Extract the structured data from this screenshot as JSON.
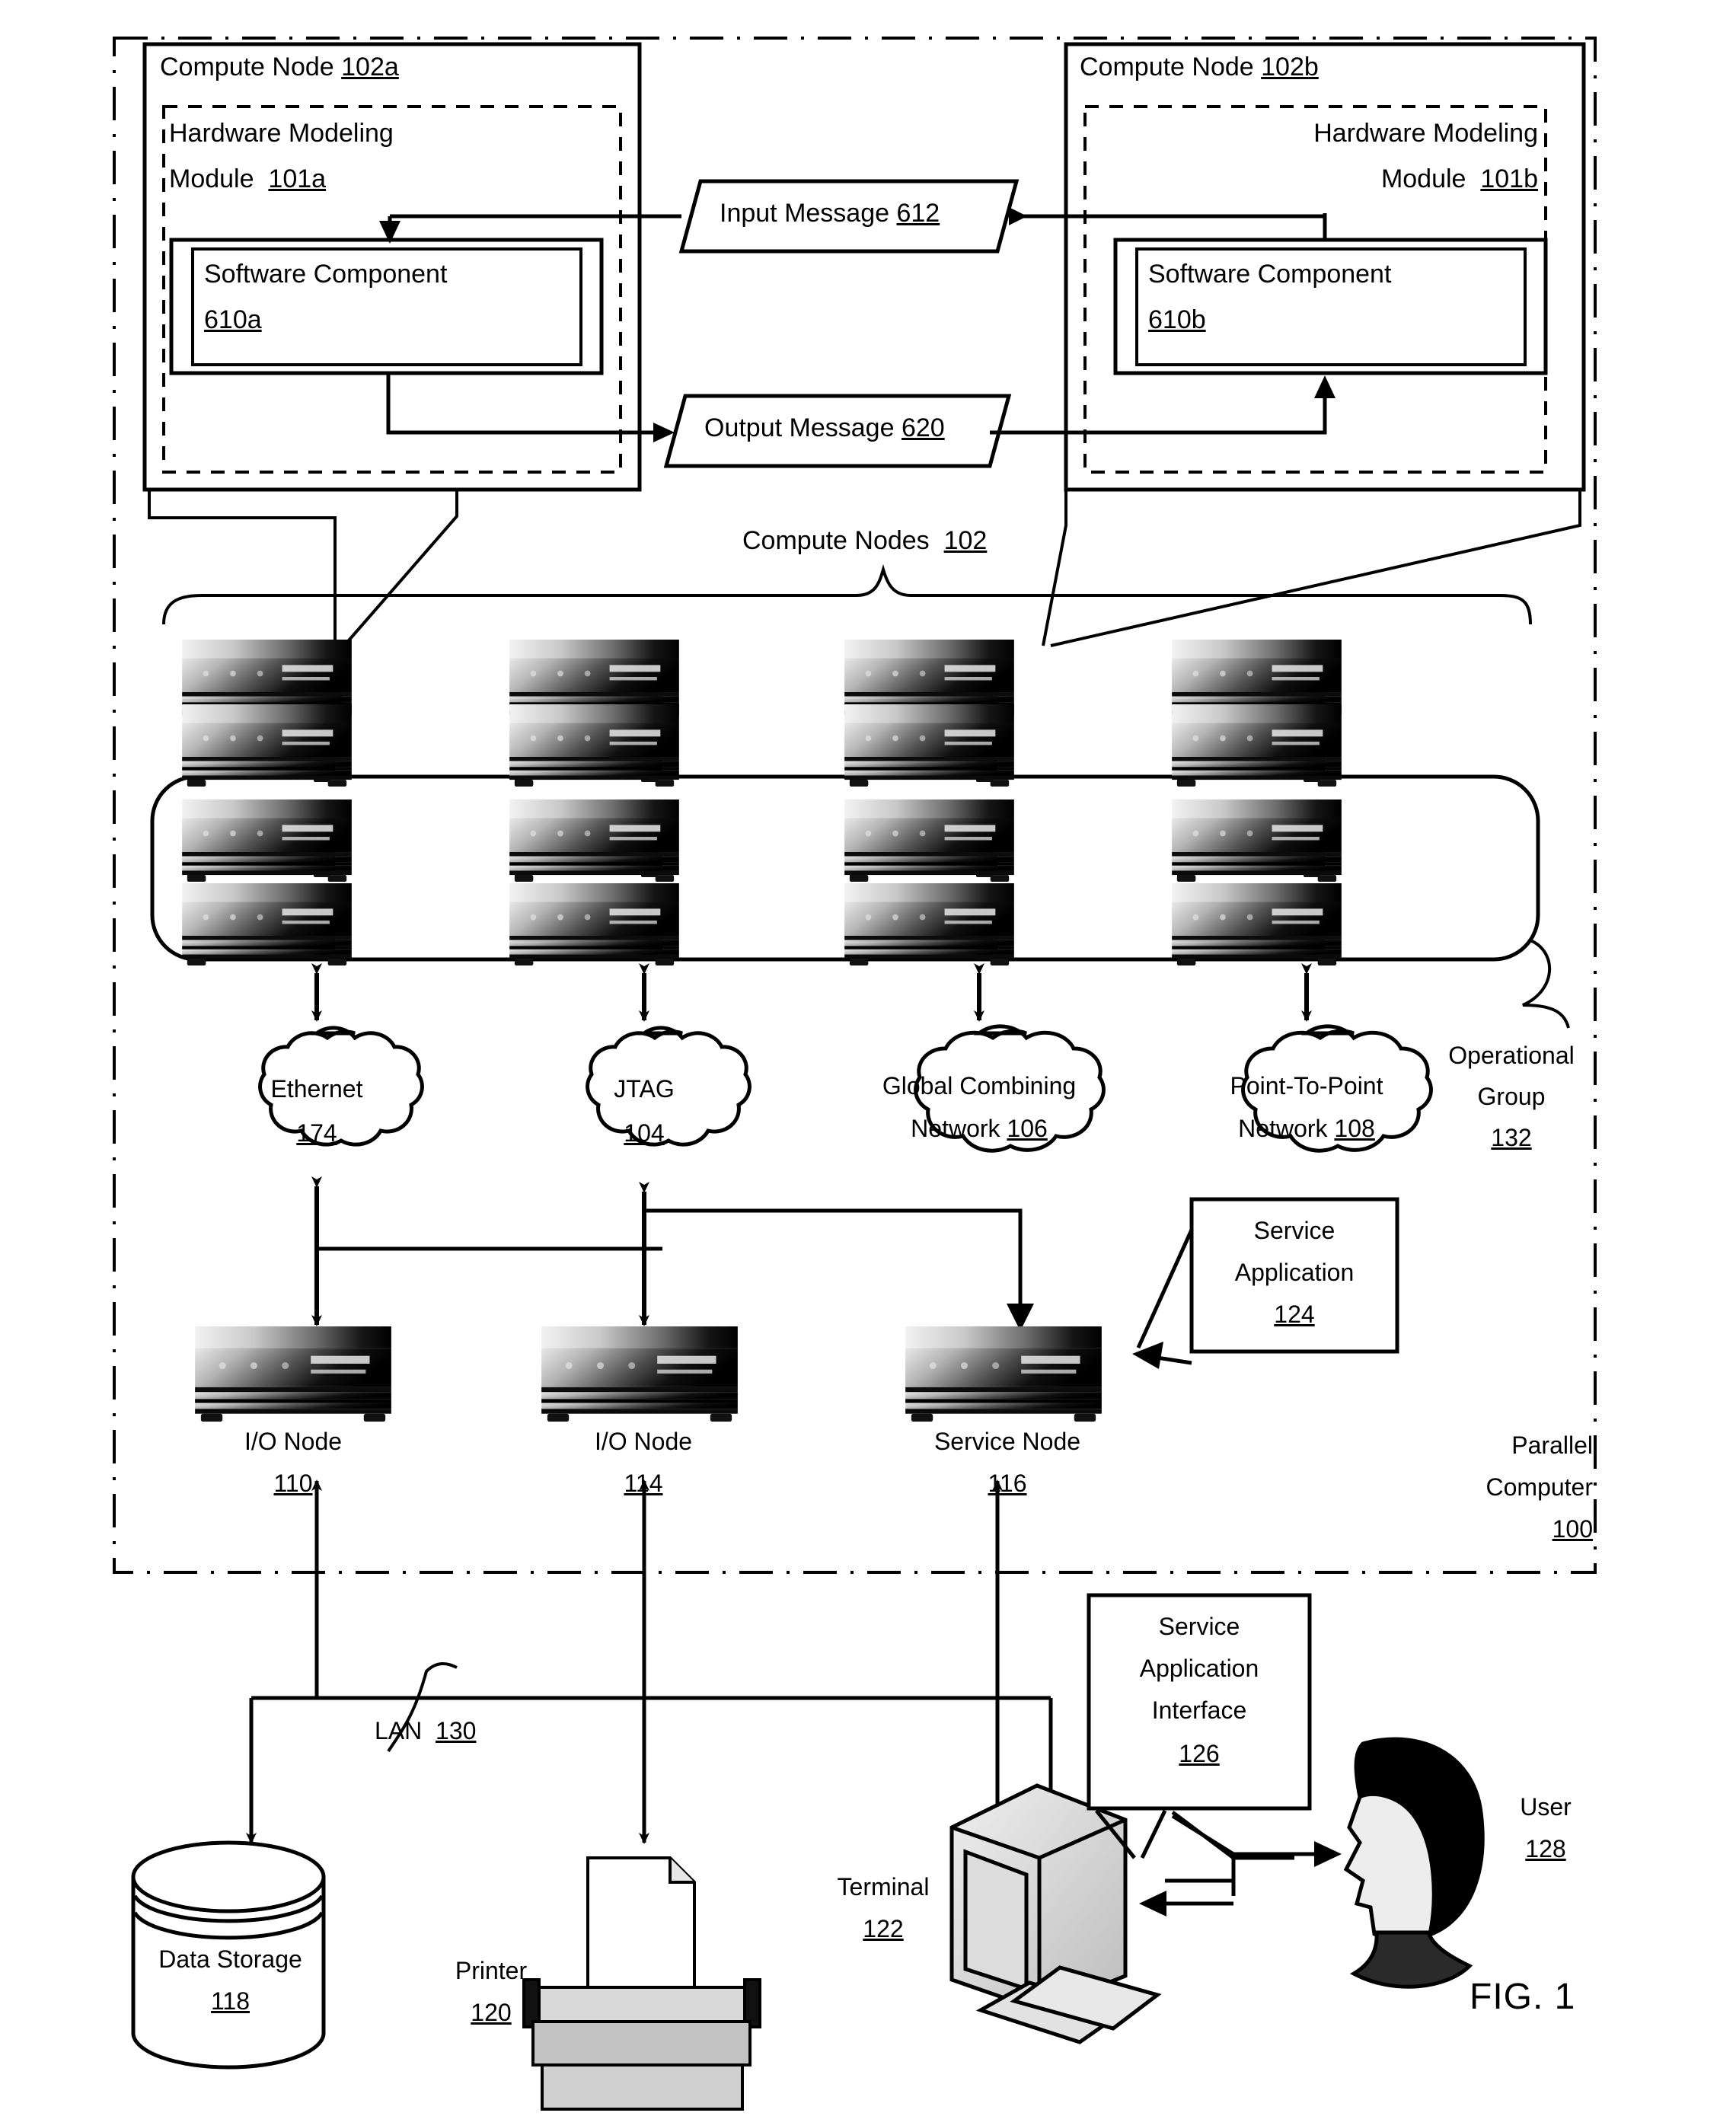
{
  "figure": {
    "caption": "FIG. 1",
    "outer_label_line1": "Parallel",
    "outer_label_line2": "Computer",
    "outer_label_ref": "100"
  },
  "compute_node_a": {
    "title": "Compute Node",
    "title_ref": "102a",
    "module_line1": "Hardware Modeling",
    "module_line2": "Module",
    "module_ref": "101a",
    "component_line1": "Software Component",
    "component_ref": "610a"
  },
  "compute_node_b": {
    "title": "Compute Node",
    "title_ref": "102b",
    "module_line1": "Hardware Modeling",
    "module_line2": "Module",
    "module_ref": "101b",
    "component_line1": "Software Component",
    "component_ref": "610b"
  },
  "messages": {
    "input": "Input Message",
    "input_ref": "612",
    "output": "Output Message",
    "output_ref": "620"
  },
  "compute_nodes_group": {
    "label": "Compute Nodes",
    "ref": "102",
    "rows": 4,
    "cols": 4
  },
  "operational_group": {
    "line1": "Operational",
    "line2": "Group",
    "ref": "132"
  },
  "networks": [
    {
      "name": "Ethernet",
      "ref": "174",
      "line2": ""
    },
    {
      "name": "JTAG",
      "ref": "104",
      "line2": ""
    },
    {
      "name": "Global Combining",
      "line2": "Network",
      "ref": "106"
    },
    {
      "name": "Point-To-Point",
      "line2": "Network",
      "ref": "108"
    }
  ],
  "nodes": [
    {
      "label": "I/O Node",
      "ref": "110"
    },
    {
      "label": "I/O Node",
      "ref": "114"
    },
    {
      "label": "Service Node",
      "ref": "116"
    }
  ],
  "service_application": {
    "line1": "Service",
    "line2": "Application",
    "ref": "124"
  },
  "service_application_interface": {
    "line1": "Service",
    "line2": "Application",
    "line3": "Interface",
    "ref": "126"
  },
  "lan": {
    "label": "LAN",
    "ref": "130"
  },
  "peripherals": {
    "data_storage": {
      "label1": "Data Storage",
      "ref": "118"
    },
    "printer": {
      "label": "Printer",
      "ref": "120"
    },
    "terminal": {
      "label": "Terminal",
      "ref": "122"
    },
    "user": {
      "label": "User",
      "ref": "128"
    }
  }
}
